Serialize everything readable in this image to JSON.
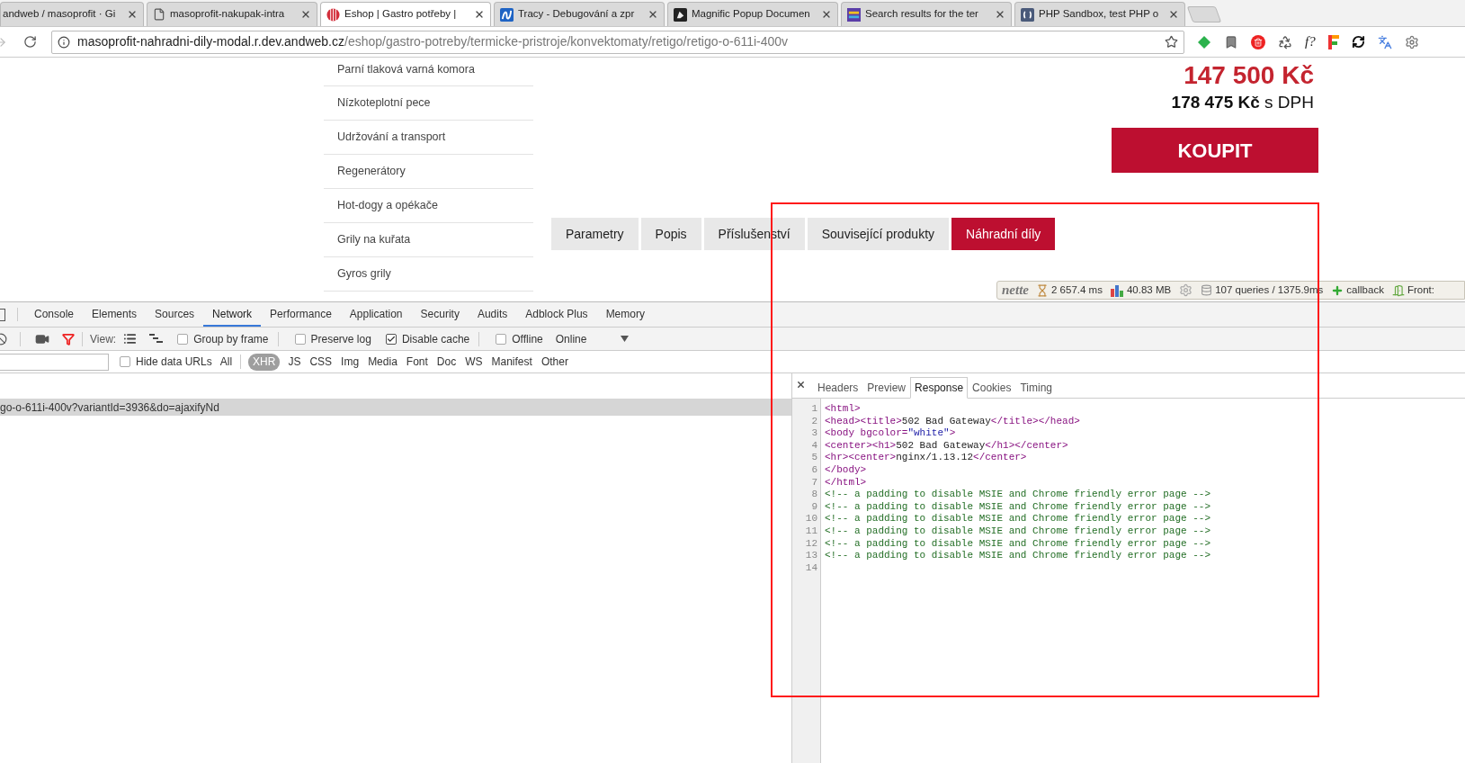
{
  "browser_tabs": [
    {
      "title": "andweb / masoprofit · Gi",
      "selected": false
    },
    {
      "title": "masoprofit-nakupak-intra",
      "kind": "file",
      "selected": false
    },
    {
      "title": "Eshop | Gastro potřeby |",
      "kind": "stripes",
      "selected": true
    },
    {
      "title": "Tracy - Debugování a zpr",
      "kind": "tracy",
      "selected": false
    },
    {
      "title": "Magnific Popup Documen",
      "kind": "dark",
      "selected": false
    },
    {
      "title": "Search results for the ter",
      "kind": "search",
      "selected": false
    },
    {
      "title": "PHP Sandbox, test PHP o",
      "kind": "php",
      "selected": false
    }
  ],
  "address_bar": {
    "host": "masoprofit-nahradni-dily-modal.r.dev.andweb.cz",
    "path": "/eshop/gastro-potreby/termicke-pristroje/konvektomaty/retigo/retigo-o-611i-400v"
  },
  "extension_label": "f?",
  "page": {
    "sidebar": [
      "Parní tlaková varná komora",
      "Nízkoteplotní pece",
      "Udržování a transport",
      "Regenerátory",
      "Hot-dogy a opékače",
      "Grily na kuřata",
      "Gyros grily"
    ],
    "price": "147 500 Kč",
    "price_vat": "**178 475 Kč** s DPH",
    "buy_button": "KOUPIT",
    "product_tabs": [
      {
        "label": "Parametry",
        "selected": false
      },
      {
        "label": "Popis",
        "selected": false
      },
      {
        "label": "Příslušenství",
        "selected": false
      },
      {
        "label": "Související produkty",
        "selected": false
      },
      {
        "label": "Náhradní díly",
        "selected": true
      }
    ]
  },
  "debug_bar": {
    "logo": "nette",
    "items": [
      {
        "kind": "time",
        "text": "2 657.4 ms"
      },
      {
        "kind": "memory",
        "text": "40.83 MB"
      },
      {
        "kind": "settings"
      },
      {
        "kind": "queries",
        "text": "107 queries / 1375.9ms"
      },
      {
        "kind": "callback",
        "text": "callback"
      },
      {
        "kind": "front",
        "text": "Front:"
      }
    ]
  },
  "devtools": {
    "tabs": [
      {
        "label": "Console",
        "selected": false
      },
      {
        "label": "Elements",
        "selected": false
      },
      {
        "label": "Sources",
        "selected": false
      },
      {
        "label": "Network",
        "selected": true
      },
      {
        "label": "Performance",
        "selected": false
      },
      {
        "label": "Application",
        "selected": false
      },
      {
        "label": "Security",
        "selected": false
      },
      {
        "label": "Audits",
        "selected": false
      },
      {
        "label": "Adblock Plus",
        "selected": false
      },
      {
        "label": "Memory",
        "selected": false
      }
    ],
    "view_label": "View:",
    "checkbox_groups": [
      [
        {
          "label": "Group by frame",
          "checked": false
        }
      ],
      [
        {
          "label": "Preserve log",
          "checked": false
        },
        {
          "label": "Disable cache",
          "checked": true
        }
      ],
      [
        {
          "label": "Offline",
          "checked": false
        }
      ]
    ],
    "throttle": "Online",
    "hide_data_urls": {
      "label": "Hide data URLs",
      "checked": false
    },
    "types": [
      {
        "label": "All",
        "selected": false
      },
      {
        "label": "XHR",
        "selected": true
      },
      {
        "label": "JS",
        "selected": false
      },
      {
        "label": "CSS",
        "selected": false
      },
      {
        "label": "Img",
        "selected": false
      },
      {
        "label": "Media",
        "selected": false
      },
      {
        "label": "Font",
        "selected": false
      },
      {
        "label": "Doc",
        "selected": false
      },
      {
        "label": "WS",
        "selected": false
      },
      {
        "label": "Manifest",
        "selected": false
      },
      {
        "label": "Other",
        "selected": false
      }
    ],
    "requests": [
      {
        "name": "go-o-611i-400v?variantId=3936&do=ajaxifyNd",
        "selected": true
      }
    ],
    "detail_tabs": [
      {
        "label": "Headers",
        "selected": false
      },
      {
        "label": "Preview",
        "selected": false
      },
      {
        "label": "Response",
        "selected": true
      },
      {
        "label": "Cookies",
        "selected": false
      },
      {
        "label": "Timing",
        "selected": false
      }
    ],
    "response_lines": [
      {
        "number": "1",
        "kind": "markup",
        "text": "<html>"
      },
      {
        "number": "2",
        "kind": "markup",
        "text": "<head><title>502 Bad Gateway</title></head>"
      },
      {
        "number": "3",
        "kind": "markup",
        "text": "<body bgcolor=\"white\">"
      },
      {
        "number": "4",
        "kind": "markup",
        "text": "<center><h1>502 Bad Gateway</h1></center>"
      },
      {
        "number": "5",
        "kind": "markup",
        "text": "<hr><center>nginx/1.13.12</center>"
      },
      {
        "number": "6",
        "kind": "markup",
        "text": "</body>"
      },
      {
        "number": "7",
        "kind": "markup",
        "text": "</html>"
      },
      {
        "number": "8",
        "kind": "comment",
        "text": "<!-- a padding to disable MSIE and Chrome friendly error page -->"
      },
      {
        "number": "9",
        "kind": "comment",
        "text": "<!-- a padding to disable MSIE and Chrome friendly error page -->"
      },
      {
        "number": "10",
        "kind": "comment",
        "text": "<!-- a padding to disable MSIE and Chrome friendly error page -->"
      },
      {
        "number": "11",
        "kind": "comment",
        "text": "<!-- a padding to disable MSIE and Chrome friendly error page -->"
      },
      {
        "number": "12",
        "kind": "comment",
        "text": "<!-- a padding to disable MSIE and Chrome friendly error page -->"
      },
      {
        "number": "13",
        "kind": "comment",
        "text": "<!-- a padding to disable MSIE and Chrome friendly error page -->"
      },
      {
        "number": "14"
      }
    ]
  }
}
